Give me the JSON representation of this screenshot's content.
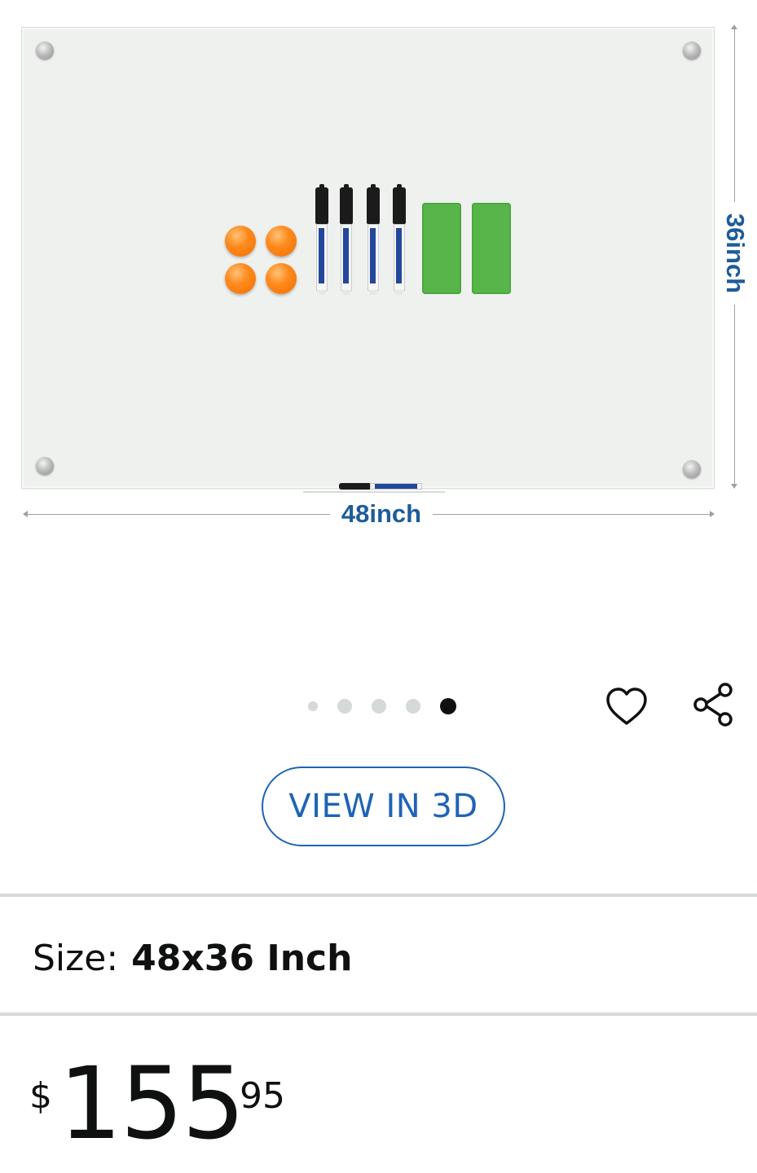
{
  "product_image": {
    "width_label": "48inch",
    "height_label": "36inch"
  },
  "carousel": {
    "total_images": 5,
    "active_index": 4
  },
  "actions": {
    "wishlist_icon": "heart-outline-icon",
    "share_icon": "share-icon"
  },
  "view_3d": {
    "label": "VIEW IN 3D"
  },
  "variation": {
    "label": "Size:",
    "value": "48x36 Inch"
  },
  "price": {
    "symbol": "$",
    "whole": "155",
    "fraction": "95"
  },
  "colors": {
    "accent_blue": "#1f63b5",
    "dimension_blue": "#1d5c9a",
    "dot_inactive": "#d5d9d9",
    "dot_active": "#0f1111"
  }
}
